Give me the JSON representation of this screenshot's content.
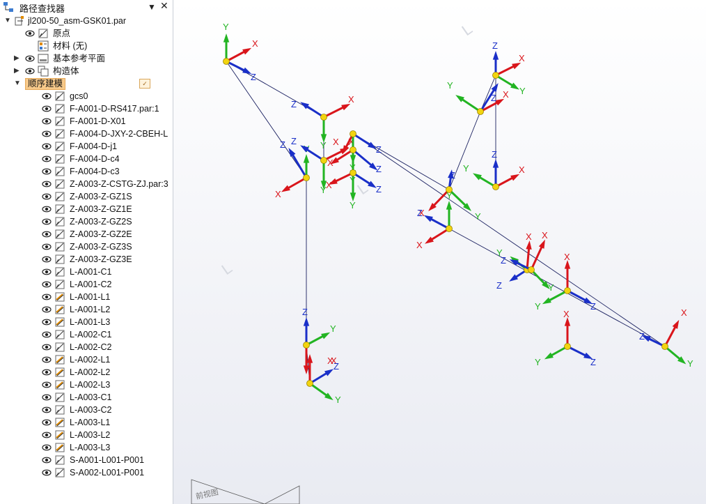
{
  "finder": {
    "title": "路径查找器",
    "pin_glyph": "▼",
    "close_glyph": "✕",
    "root": "jl200-50_asm-GSK01.par",
    "items": [
      {
        "label": "原点",
        "indent": 1,
        "arrow": "",
        "eye": true,
        "icon": "sketch-icon"
      },
      {
        "label": "材料 (无)",
        "indent": 1,
        "arrow": "",
        "eye": false,
        "icon": "material-icon"
      },
      {
        "label": "基本参考平面",
        "indent": 0,
        "arrow": "▶",
        "eye": true,
        "icon": "plane-icon"
      },
      {
        "label": "构造体",
        "indent": 0,
        "arrow": "▶",
        "eye": true,
        "icon": "construction-icon"
      },
      {
        "label": "顺序建模",
        "indent": 0,
        "arrow": "▼",
        "eye": false,
        "icon": "",
        "selected": true
      },
      {
        "label": "gcs0",
        "indent": 2,
        "arrow": "",
        "eye": true,
        "icon": "sketch-icon"
      },
      {
        "label": "F-A001-D-RS417.par:1",
        "indent": 2,
        "arrow": "",
        "eye": true,
        "icon": "sketch-icon"
      },
      {
        "label": "F-A001-D-X01",
        "indent": 2,
        "arrow": "",
        "eye": true,
        "icon": "sketch-icon"
      },
      {
        "label": "F-A004-D-JXY-2-CBEH-L",
        "indent": 2,
        "arrow": "",
        "eye": true,
        "icon": "sketch-icon"
      },
      {
        "label": "F-A004-D-j1",
        "indent": 2,
        "arrow": "",
        "eye": true,
        "icon": "sketch-icon"
      },
      {
        "label": "F-A004-D-c4",
        "indent": 2,
        "arrow": "",
        "eye": true,
        "icon": "sketch-icon"
      },
      {
        "label": "F-A004-D-c3",
        "indent": 2,
        "arrow": "",
        "eye": true,
        "icon": "sketch-icon"
      },
      {
        "label": "Z-A003-Z-CSTG-ZJ.par:3",
        "indent": 2,
        "arrow": "",
        "eye": true,
        "icon": "sketch-icon"
      },
      {
        "label": "Z-A003-Z-GZ1S",
        "indent": 2,
        "arrow": "",
        "eye": true,
        "icon": "sketch-icon"
      },
      {
        "label": "Z-A003-Z-GZ1E",
        "indent": 2,
        "arrow": "",
        "eye": true,
        "icon": "sketch-icon"
      },
      {
        "label": "Z-A003-Z-GZ2S",
        "indent": 2,
        "arrow": "",
        "eye": true,
        "icon": "sketch-icon"
      },
      {
        "label": "Z-A003-Z-GZ2E",
        "indent": 2,
        "arrow": "",
        "eye": true,
        "icon": "sketch-icon"
      },
      {
        "label": "Z-A003-Z-GZ3S",
        "indent": 2,
        "arrow": "",
        "eye": true,
        "icon": "sketch-icon"
      },
      {
        "label": "Z-A003-Z-GZ3E",
        "indent": 2,
        "arrow": "",
        "eye": true,
        "icon": "sketch-icon"
      },
      {
        "label": "L-A001-C1",
        "indent": 2,
        "arrow": "",
        "eye": true,
        "icon": "sketch-icon"
      },
      {
        "label": "L-A001-C2",
        "indent": 2,
        "arrow": "",
        "eye": true,
        "icon": "sketch-icon"
      },
      {
        "label": "L-A001-L1",
        "indent": 2,
        "arrow": "",
        "eye": true,
        "icon": "line-icon"
      },
      {
        "label": "L-A001-L2",
        "indent": 2,
        "arrow": "",
        "eye": true,
        "icon": "line-icon"
      },
      {
        "label": "L-A001-L3",
        "indent": 2,
        "arrow": "",
        "eye": true,
        "icon": "line-icon"
      },
      {
        "label": "L-A002-C1",
        "indent": 2,
        "arrow": "",
        "eye": true,
        "icon": "sketch-icon"
      },
      {
        "label": "L-A002-C2",
        "indent": 2,
        "arrow": "",
        "eye": true,
        "icon": "sketch-icon"
      },
      {
        "label": "L-A002-L1",
        "indent": 2,
        "arrow": "",
        "eye": true,
        "icon": "line-icon"
      },
      {
        "label": "L-A002-L2",
        "indent": 2,
        "arrow": "",
        "eye": true,
        "icon": "line-icon"
      },
      {
        "label": "L-A002-L3",
        "indent": 2,
        "arrow": "",
        "eye": true,
        "icon": "line-icon"
      },
      {
        "label": "L-A003-C1",
        "indent": 2,
        "arrow": "",
        "eye": true,
        "icon": "sketch-icon"
      },
      {
        "label": "L-A003-C2",
        "indent": 2,
        "arrow": "",
        "eye": true,
        "icon": "sketch-icon"
      },
      {
        "label": "L-A003-L1",
        "indent": 2,
        "arrow": "",
        "eye": true,
        "icon": "line-icon"
      },
      {
        "label": "L-A003-L2",
        "indent": 2,
        "arrow": "",
        "eye": true,
        "icon": "line-icon"
      },
      {
        "label": "L-A003-L3",
        "indent": 2,
        "arrow": "",
        "eye": true,
        "icon": "line-icon"
      },
      {
        "label": "S-A001-L001-P001",
        "indent": 2,
        "arrow": "",
        "eye": true,
        "icon": "sketch-icon"
      },
      {
        "label": "S-A002-L001-P001",
        "indent": 2,
        "arrow": "",
        "eye": true,
        "icon": "sketch-icon"
      }
    ]
  },
  "viewport": {
    "watermark_letter": "L",
    "front_view_label": "前视图",
    "axis_letters": {
      "x": "X",
      "y": "Y",
      "z": "Z"
    },
    "colors": {
      "x_axis": "#d9151b",
      "y_axis": "#22b422",
      "z_axis": "#1a2fc8",
      "origin": "#f2d40f",
      "line": "#1a2060"
    }
  }
}
